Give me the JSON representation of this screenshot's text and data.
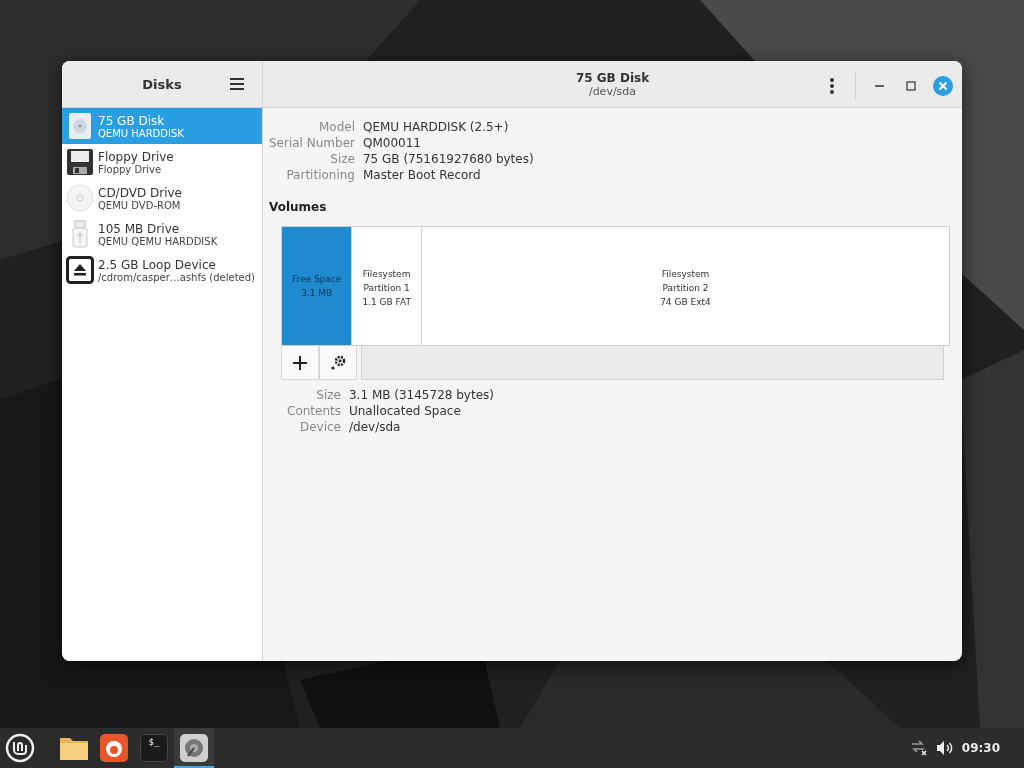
{
  "sidebar": {
    "title": "Disks",
    "items": [
      {
        "kind": "harddisk",
        "name": "75 GB Disk",
        "detail": "QEMU HARDDISK",
        "selected": true
      },
      {
        "kind": "floppy",
        "name": "Floppy Drive",
        "detail": "Floppy Drive",
        "selected": false
      },
      {
        "kind": "optical",
        "name": "CD/DVD Drive",
        "detail": "QEMU DVD-ROM",
        "selected": false
      },
      {
        "kind": "usb",
        "name": "105 MB Drive",
        "detail": "QEMU QEMU HARDDISK",
        "selected": false
      },
      {
        "kind": "loop",
        "name": "2.5 GB Loop Device",
        "detail": "/cdrom/casper…ashfs (deleted)",
        "selected": false
      }
    ]
  },
  "header": {
    "title": "75 GB Disk",
    "subtitle": "/dev/sda"
  },
  "disk_info": [
    {
      "label": "Model",
      "value": "QEMU HARDDISK (2.5+)"
    },
    {
      "label": "Serial Number",
      "value": "QM00011"
    },
    {
      "label": "Size",
      "value": "75 GB (75161927680 bytes)"
    },
    {
      "label": "Partitioning",
      "value": "Master Boot Record"
    }
  ],
  "volumes": {
    "title": "Volumes",
    "segments": [
      {
        "kind": "free",
        "lines": [
          "Free Space",
          "3.1 MB"
        ],
        "selected": true
      },
      {
        "kind": "filesystem",
        "lines": [
          "Filesystem",
          "Partition 1",
          "1.1 GB FAT"
        ],
        "selected": false
      },
      {
        "kind": "filesystem",
        "lines": [
          "Filesystem",
          "Partition 2",
          "74 GB Ext4"
        ],
        "selected": false
      }
    ],
    "toolbar": [
      {
        "kind": "add"
      },
      {
        "kind": "settings"
      }
    ]
  },
  "volume_info": [
    {
      "label": "Size",
      "value": "3.1 MB (3145728 bytes)"
    },
    {
      "label": "Contents",
      "value": "Unallocated Space"
    },
    {
      "label": "Device",
      "value": "/dev/sda"
    }
  ],
  "taskbar": {
    "apps": [
      {
        "kind": "files",
        "selected": false
      },
      {
        "kind": "browser",
        "selected": false
      },
      {
        "kind": "terminal",
        "glyph": "$_",
        "selected": false
      },
      {
        "kind": "disks",
        "selected": true
      }
    ],
    "clock": "09:30"
  }
}
